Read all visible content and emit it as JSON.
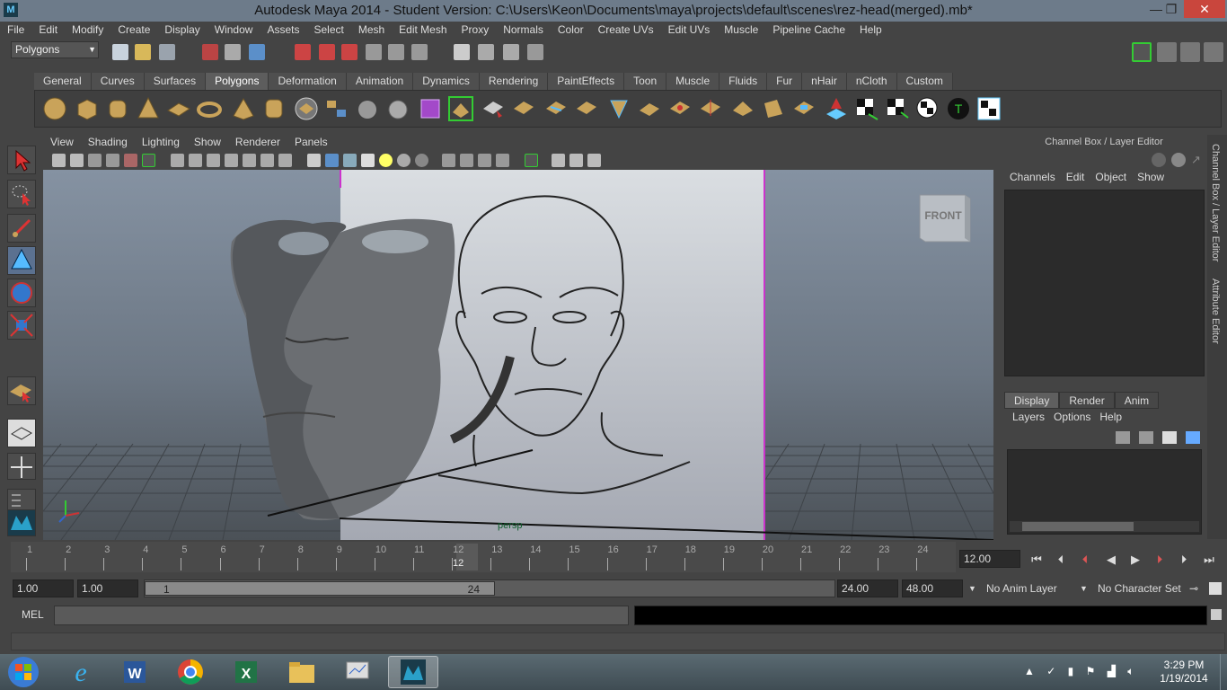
{
  "window": {
    "title": "Autodesk Maya 2014 - Student Version: C:\\Users\\Keon\\Documents\\maya\\projects\\default\\scenes\\rez-head(merged).mb*",
    "min": "—",
    "max": "❐",
    "close": "✕"
  },
  "menu": [
    "File",
    "Edit",
    "Modify",
    "Create",
    "Display",
    "Window",
    "Assets",
    "Select",
    "Mesh",
    "Edit Mesh",
    "Proxy",
    "Normals",
    "Color",
    "Create UVs",
    "Edit UVs",
    "Muscle",
    "Pipeline Cache",
    "Help"
  ],
  "statusline": {
    "mode": "Polygons"
  },
  "shelf": {
    "tabs": [
      "General",
      "Curves",
      "Surfaces",
      "Polygons",
      "Deformation",
      "Animation",
      "Dynamics",
      "Rendering",
      "PaintEffects",
      "Toon",
      "Muscle",
      "Fluids",
      "Fur",
      "nHair",
      "nCloth",
      "Custom"
    ],
    "active_tab": "Polygons"
  },
  "panel": {
    "menu": [
      "View",
      "Shading",
      "Lighting",
      "Show",
      "Renderer",
      "Panels"
    ],
    "camera": "persp",
    "viewcube": "FRONT"
  },
  "channelbox": {
    "title": "Channel Box / Layer Editor",
    "menu": [
      "Channels",
      "Edit",
      "Object",
      "Show"
    ],
    "side_tabs": [
      "Channel Box / Layer Editor",
      "Attribute Editor"
    ]
  },
  "layers": {
    "tabs": [
      "Display",
      "Render",
      "Anim"
    ],
    "active_tab": "Display",
    "menu": [
      "Layers",
      "Options",
      "Help"
    ]
  },
  "timeline": {
    "ticks": [
      "1",
      "2",
      "3",
      "4",
      "5",
      "6",
      "7",
      "8",
      "9",
      "10",
      "11",
      "12",
      "13",
      "14",
      "15",
      "16",
      "17",
      "18",
      "19",
      "20",
      "21",
      "22",
      "23",
      "24"
    ],
    "current_frame": "12",
    "current_frame_field": "12.00"
  },
  "range": {
    "start": "1.00",
    "playback_start": "1.00",
    "handle_start": "1",
    "handle_end": "24",
    "playback_end": "24.00",
    "end": "48.00",
    "anim_layer": "No Anim Layer",
    "character_set": "No Character Set"
  },
  "cmd": {
    "label": "MEL"
  },
  "taskbar": {
    "time": "3:29 PM",
    "date": "1/19/2014"
  }
}
